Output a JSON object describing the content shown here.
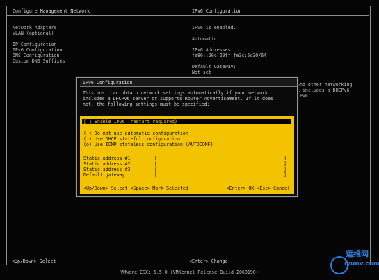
{
  "header": {
    "left_title": "Configure Management Network",
    "right_title": "IPv6 Configuration"
  },
  "menu": {
    "items": [
      "Network Adapters",
      "VLAN (optional)",
      "",
      "IP Configuration",
      "IPv6 Configuration",
      "DNS Configuration",
      "Custom DNS Suffixes"
    ]
  },
  "info": {
    "lines": [
      "IPv6 is enabled.",
      "",
      "Automatic",
      "",
      "IPv6 Addresses:",
      "fe80::20c:29ff:fe3c:5c30/64",
      "",
      "Default Gateway:",
      "Not set"
    ]
  },
  "bleed_text": [
    "and other networking",
    "k includes a DHCPv6",
    "IPv6"
  ],
  "dialog": {
    "title": "IPv6 Configuration",
    "description": [
      "This host can obtain network settings automatically if your network",
      "includes a DHCPv6 server or supports Router Advertisement. If it does",
      "not, the following settings must be specified:"
    ],
    "enable_option": "[ ] Enable IPv6 (restart required)",
    "options": [
      "( ) Do not use automatic configuration",
      "( ) Use DHCP stateful configuration",
      "(o) Use ICMP stateless configuration (AUTOCONF)"
    ],
    "fields": [
      {
        "label": "Static address #1",
        "value": ""
      },
      {
        "label": "Static address #2",
        "value": ""
      },
      {
        "label": "Static address #3",
        "value": ""
      },
      {
        "label": "Default gateway",
        "value": ""
      }
    ],
    "keys_left": "<Up/Down> Select   <Space> Mark Selected",
    "keys_right": "<Enter> OK   <Esc> Cancel"
  },
  "footer": {
    "left": "<Up/Down> Select",
    "right": "<Enter> Change",
    "build": "VMware ESXi 5.5.0 (VMKernel Release Build 2068190)"
  },
  "watermark": {
    "text": "运维网",
    "domain": "iyunv.com"
  },
  "colors": {
    "background": "#050505",
    "dialog_yellow": "#f3c200",
    "text": "#bdbdbd"
  }
}
